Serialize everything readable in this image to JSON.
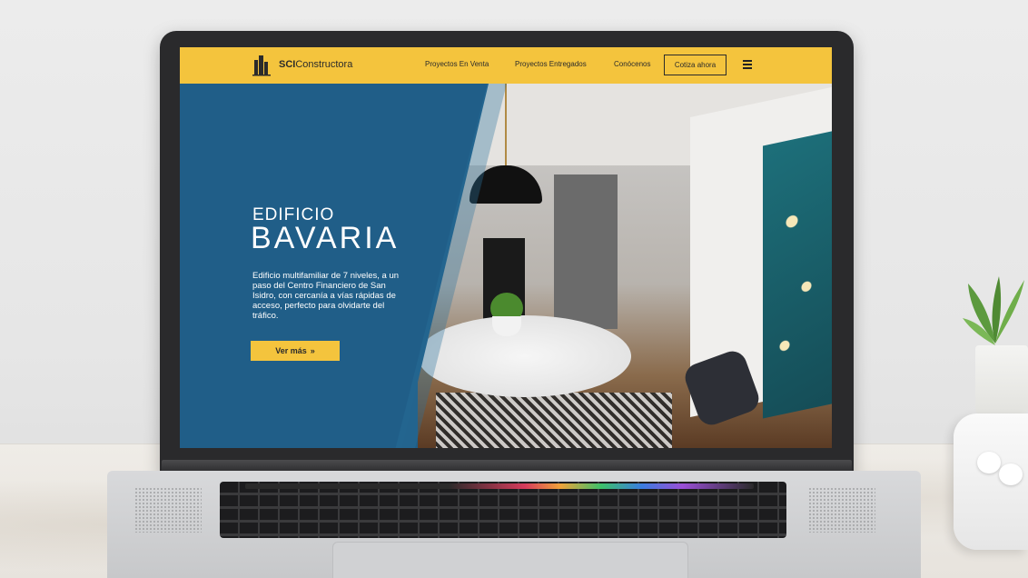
{
  "nav": {
    "brand_strong": "SCI",
    "brand_rest": "Constructora",
    "links": [
      "Proyectos En Venta",
      "Proyectos Entregados",
      "Conócenos"
    ],
    "cta": "Cotiza ahora",
    "menu_icon": "hamburger-menu-icon"
  },
  "hero": {
    "subtitle": "EDIFICIO",
    "title": "BAVARIA",
    "description": "Edificio multifamiliar de 7 niveles, a un paso del Centro Financiero de San Isidro, con cercanía a vías rápidas de acceso, perfecto para olvidarte del tráfico.",
    "button_label": "Ver más",
    "button_icon": "double-chevron-right-icon"
  },
  "colors": {
    "nav_yellow": "#f4c43d",
    "hero_blue": "#205e88",
    "text_dark": "#2b2b2b"
  }
}
